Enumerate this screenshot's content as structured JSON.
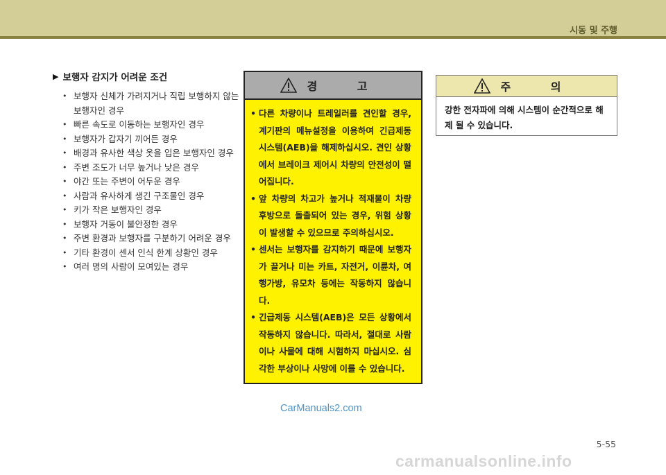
{
  "header": {
    "chapter_title": "시동 및 주행"
  },
  "conditions": {
    "title": "보행자 감지가 어려운 조건",
    "items": [
      "보행자 신체가 가려지거나 직립 보행하지 않는 보행자인 경우",
      "빠른 속도로 이동하는 보행자인 경우",
      "보행자가 갑자기 끼어든 경우",
      "배경과 유사한 색상 옷을 입은 보행자인 경우",
      "주변 조도가 너무 높거나 낮은 경우",
      "야간 또는 주변이 어두운 경우",
      "사람과 유사하게 생긴 구조물인 경우",
      "키가 작은 보행자인 경우",
      "보행자 거동이 불안정한 경우",
      "주변 환경과 보행자를 구분하기 어려운 경우",
      "기타 환경이 센서 인식 한계 상황인 경우",
      "여러 명의 사람이 모여있는 경우"
    ]
  },
  "warning": {
    "title": "경 고",
    "items": [
      "다른 차량이나 트레일러를 견인할 경우, 계기판의 메뉴설정을 이용하여 긴급제동 시스템(AEB)을 해제하십시오. 견인 상황에서 브레이크 제어시 차량의 안전성이 떨어집니다.",
      "앞 차량의 차고가 높거나 적재물이 차량 후방으로 돌출되어 있는 경우, 위험 상황이 발생할 수 있으므로 주의하십시오.",
      "센서는 보행자를 감지하기 때문에 보행자가 끌거나 미는 카트, 자전거, 이륜차, 여행가방, 유모차 등에는 작동하지 않습니다.",
      "긴급제동 시스템(AEB)은 모든 상황에서 작동하지 않습니다. 따라서, 절대로 사람이나 사물에 대해 시험하지 마십시오. 심각한 부상이나 사망에 이를 수 있습니다."
    ]
  },
  "caution": {
    "title": "주 의",
    "text": "강한 전자파에 의해 시스템이 순간적으로 해제 될 수 있습니다."
  },
  "watermark": "CarManuals2.com",
  "page_number": "5-55",
  "footer_watermark": "carmanualsonline.info",
  "colors": {
    "header_band": "#d3ce97",
    "header_rule": "#8a8240",
    "warning_bg": "#fff200",
    "warning_head": "#ababab",
    "caution_head": "#eee7ad",
    "watermark": "#4d94c9"
  },
  "icons": {
    "section_marker": "triangle-right-icon",
    "box_alert": "warning-triangle-icon"
  }
}
